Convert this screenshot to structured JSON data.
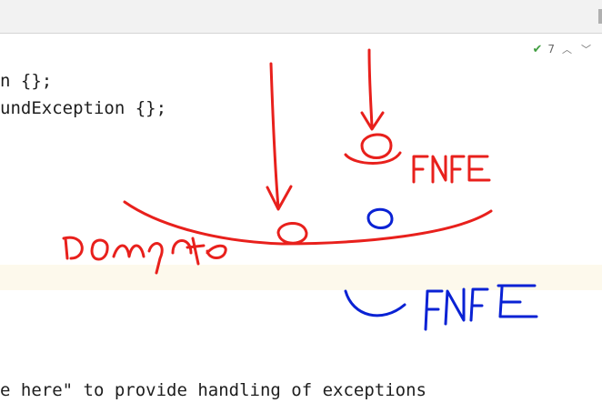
{
  "inspection": {
    "count": "7",
    "check_icon": "check-icon",
    "up_icon": "chevron-up-icon",
    "down_icon": "chevron-down-icon",
    "color": "#3f9d3f"
  },
  "code_lines": [
    "n {};",
    "undException {};",
    "e here\" to provide handling of exceptions"
  ],
  "annotations": {
    "label_left": "?ompta",
    "label_right_red": "fNFE",
    "label_right_blue": "fNFE",
    "colors": {
      "red": "#e8201c",
      "blue": "#0a22d4"
    }
  }
}
